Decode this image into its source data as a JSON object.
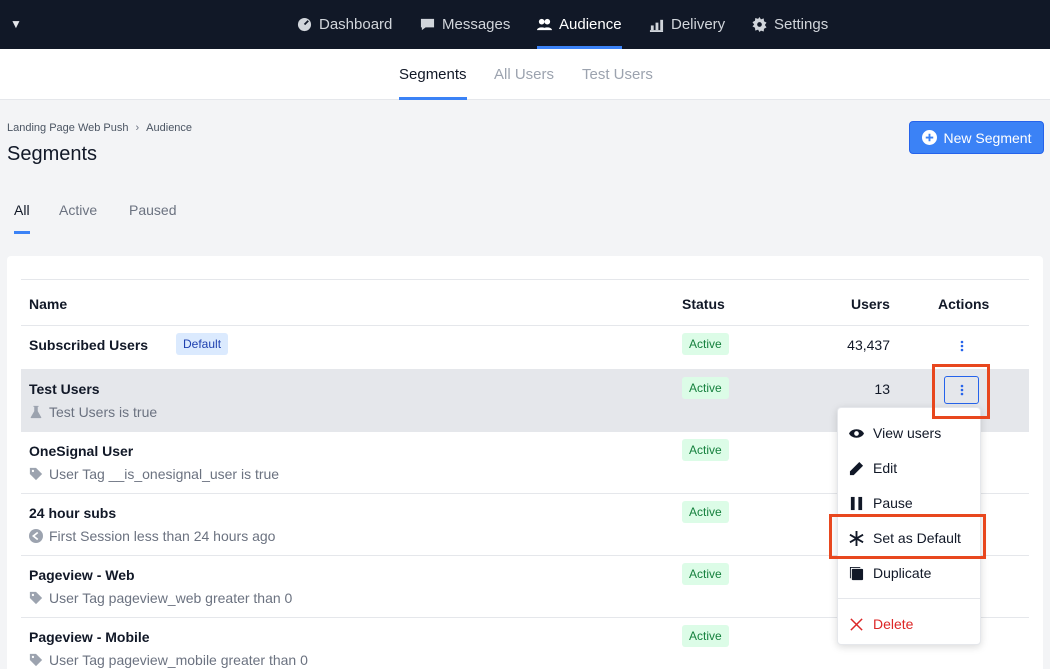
{
  "topnav": {
    "items": [
      {
        "label": "Dashboard",
        "icon": "dashboard-icon"
      },
      {
        "label": "Messages",
        "icon": "messages-icon"
      },
      {
        "label": "Audience",
        "icon": "audience-icon",
        "active": true
      },
      {
        "label": "Delivery",
        "icon": "delivery-icon"
      },
      {
        "label": "Settings",
        "icon": "settings-icon"
      }
    ]
  },
  "subnav": {
    "tabs": [
      {
        "label": "Segments",
        "active": true
      },
      {
        "label": "All Users"
      },
      {
        "label": "Test Users"
      }
    ]
  },
  "breadcrumb": {
    "app": "Landing Page Web Push",
    "section": "Audience"
  },
  "page": {
    "title": "Segments",
    "new_button": "New Segment"
  },
  "filter_tabs": [
    {
      "label": "All",
      "active": true
    },
    {
      "label": "Active"
    },
    {
      "label": "Paused"
    }
  ],
  "table": {
    "headers": {
      "name": "Name",
      "status": "Status",
      "users": "Users",
      "actions": "Actions"
    },
    "rows": [
      {
        "name": "Subscribed Users",
        "badge": "Default",
        "status": "Active",
        "users": "43,437",
        "desc": ""
      },
      {
        "name": "Test Users",
        "status": "Active",
        "users": "13",
        "desc": "Test Users is true",
        "icon": "flask-icon"
      },
      {
        "name": "OneSignal User",
        "status": "Active",
        "users": "",
        "desc": "User Tag __is_onesignal_user is true",
        "icon": "tag-icon"
      },
      {
        "name": "24 hour subs",
        "status": "Active",
        "users": "",
        "desc": "First Session less than 24 hours ago",
        "icon": "back-arrow-icon"
      },
      {
        "name": "Pageview - Web",
        "status": "Active",
        "users": "",
        "desc": "User Tag pageview_web greater than 0",
        "icon": "tag-icon"
      },
      {
        "name": "Pageview - Mobile",
        "status": "Active",
        "users": "",
        "desc": "User Tag pageview_mobile greater than 0",
        "icon": "tag-icon"
      }
    ]
  },
  "menu": {
    "items": [
      {
        "label": "View users",
        "icon": "eye-icon"
      },
      {
        "label": "Edit",
        "icon": "pencil-icon"
      },
      {
        "label": "Pause",
        "icon": "pause-icon"
      },
      {
        "label": "Set as Default",
        "icon": "asterisk-icon"
      },
      {
        "label": "Duplicate",
        "icon": "duplicate-icon"
      },
      {
        "label": "Delete",
        "icon": "x-icon"
      }
    ]
  },
  "colors": {
    "accent": "#3b82f6",
    "highlight": "#e8471e",
    "nav_bg": "#111827",
    "danger": "#dc2626"
  }
}
